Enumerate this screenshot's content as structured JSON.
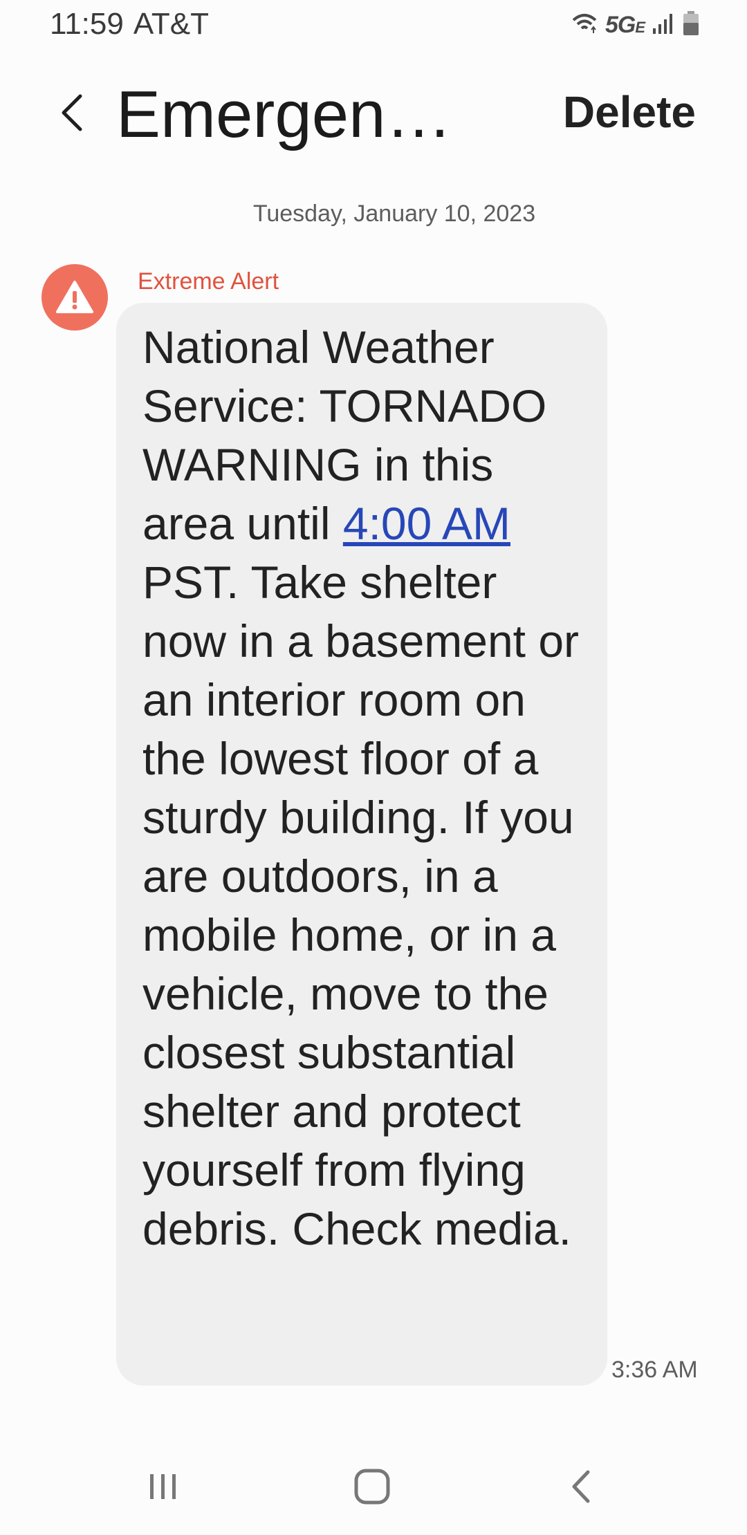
{
  "status_bar": {
    "time": "11:59",
    "carrier": "AT&T",
    "network": "5G",
    "network_suffix": "E",
    "icons": [
      "wifi-icon",
      "signal-icon",
      "battery-icon"
    ]
  },
  "header": {
    "title": "Emergenc...",
    "back_icon": "chevron-left-icon",
    "delete_label": "Delete"
  },
  "conversation": {
    "date": "Tuesday, January 10, 2023",
    "sender": {
      "label": "Extreme Alert",
      "icon": "warning-triangle-icon",
      "color": "#f0705e"
    },
    "message": {
      "text_before": "National Weather Service: TORNADO WARNING in this area until ",
      "link_text": "4:00 AM",
      "text_after": " PST. Take shelter now in a basement or an interior room on the lowest floor of a sturdy building. If you are outdoors, in a mobile home, or in a vehicle, move to the closest substantial shelter and protect yourself from flying debris. Check media.",
      "time": "3:36 AM"
    }
  },
  "nav_bar": {
    "recents_icon": "recent-apps-icon",
    "home_icon": "home-icon",
    "back_icon": "back-icon"
  },
  "colors": {
    "alert_red": "#e0523e",
    "link_blue": "#2747b8",
    "bubble_bg": "#efefef"
  }
}
